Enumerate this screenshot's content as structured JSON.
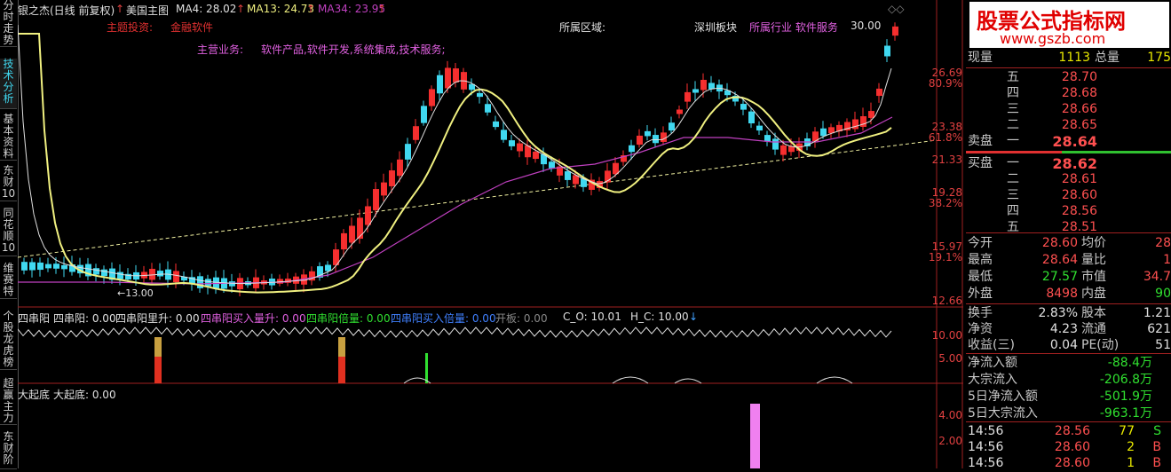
{
  "left_tabs": [
    {
      "label": "分时走势"
    },
    {
      "label": "技术分析"
    },
    {
      "label": "基本资料"
    },
    {
      "label": "东财10"
    },
    {
      "label": "同花顺10"
    },
    {
      "label": "维赛特"
    },
    {
      "label": "个股龙虎榜"
    },
    {
      "label": "超赢主力"
    },
    {
      "label": "东财阶"
    }
  ],
  "header": {
    "stock_title": "银之杰(日线 前复权)",
    "indicator_name": "美国主图",
    "ma4": "MA4: 28.02",
    "ma13": "MA13: 24.73",
    "ma34": "MA34: 23.95",
    "main_invest_label": "主题投资:",
    "main_invest_value": "金融软件",
    "region_label": "所属区域:",
    "board_label": "深圳板块",
    "industry": "所属行业 软件服务",
    "price_top": "30.00",
    "main_biz_label": "主营业务:",
    "main_biz_value": "软件产品,软件开发,系统集成,技术服务;",
    "low_marker": "13.00"
  },
  "main_axis": [
    {
      "label": "26.69",
      "color": "#e04040"
    },
    {
      "label": "80.9%",
      "color": "#e04040"
    },
    {
      "label": "23.38",
      "color": "#e04040"
    },
    {
      "label": "61.8%",
      "color": "#e04040"
    },
    {
      "label": "21.33",
      "color": "#e04040"
    },
    {
      "label": "19.28",
      "color": "#e04040"
    },
    {
      "label": "38.2%",
      "color": "#e04040"
    },
    {
      "label": "15.97",
      "color": "#e04040"
    },
    {
      "label": "19.1%",
      "color": "#e04040"
    },
    {
      "label": "12.66",
      "color": "#e04040"
    }
  ],
  "sub1": {
    "title": "四串阳",
    "v1": "四串阳: 0.00",
    "v2": "四串阳里升: 0.00",
    "v3": "四串阳买入量升: 0.00",
    "v4": "四串阳倍量: 0.00",
    "v5": "四串阳买入倍量: 0.00",
    "v6": "开板: 0.00",
    "v7": "C_O: 10.01",
    "v8": "H_C: 10.00",
    "axis1": "10.00",
    "axis2": "5.00"
  },
  "sub2": {
    "title": "大起底",
    "v1": "大起底: 0.00",
    "axis1": "4.00",
    "axis2": "2.00"
  },
  "watermark": {
    "line1": "股票公式指标网",
    "line2": "www.gszb.com"
  },
  "quote": {
    "now_vol_label": "现量",
    "now_vol": "1113",
    "total_vol_label": "总量",
    "total_vol": "175",
    "sells": [
      {
        "label": "五",
        "price": "28.70"
      },
      {
        "label": "四",
        "price": "28.68"
      },
      {
        "label": "三",
        "price": "28.66"
      },
      {
        "label": "二",
        "price": "28.65"
      },
      {
        "label": "一",
        "price": "28.64"
      }
    ],
    "sell_label": "卖盘",
    "buy_label": "买盘",
    "buys": [
      {
        "label": "一",
        "price": "28.62"
      },
      {
        "label": "二",
        "price": "28.61"
      },
      {
        "label": "三",
        "price": "28.60"
      },
      {
        "label": "四",
        "price": "28.56"
      },
      {
        "label": "五",
        "price": "28.51"
      }
    ],
    "stats": [
      {
        "l1": "今开",
        "v1": "28.60",
        "l2": "均价",
        "v2": "28"
      },
      {
        "l1": "最高",
        "v1": "28.64",
        "l2": "量比",
        "v2": "1"
      },
      {
        "l1": "最低",
        "v1": "27.57",
        "l2": "市值",
        "v2": "34.7"
      },
      {
        "l1": "外盘",
        "v1": "8498",
        "l2": "内盘",
        "v2": "90"
      }
    ],
    "stats2": [
      {
        "l1": "换手",
        "v1": "2.83%",
        "l2": "股本",
        "v2": "1.21"
      },
      {
        "l1": "净资",
        "v1": "4.23",
        "l2": "流通",
        "v2": "621"
      },
      {
        "l1": "收益(三)",
        "v1": "0.04",
        "l2": "PE(动)",
        "v2": "51"
      }
    ],
    "flows": [
      {
        "label": "净流入额",
        "value": "-88.4万"
      },
      {
        "label": "大宗流入",
        "value": "-206.8万"
      },
      {
        "label": "5日净流入额",
        "value": "-501.9万"
      },
      {
        "label": "5日大宗流入",
        "value": "-963.1万"
      }
    ],
    "ticks": [
      {
        "time": "14:56",
        "price": "28.56",
        "vol": "77",
        "side": "S"
      },
      {
        "time": "14:56",
        "price": "28.60",
        "vol": "2",
        "side": "B"
      },
      {
        "time": "14:56",
        "price": "28.60",
        "vol": "1",
        "side": "B"
      }
    ]
  },
  "colors": {
    "up": "#ff3030",
    "down": "#40d8f0",
    "ma4": "#e0e0e0",
    "ma13": "#f0f080",
    "ma34": "#c040c0",
    "magenta": "#ff60ff"
  }
}
